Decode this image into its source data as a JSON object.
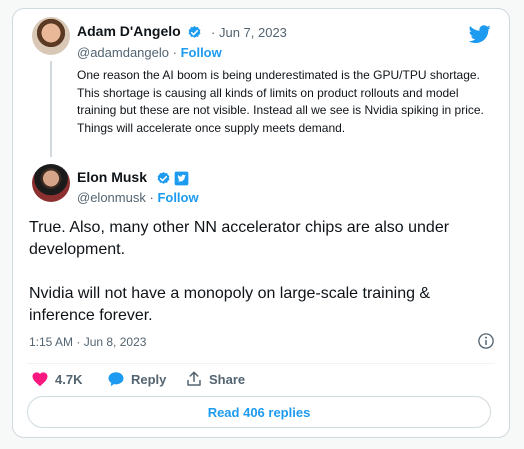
{
  "quoted_tweet": {
    "author_name": "Adam D'Angelo",
    "handle": "@adamdangelo",
    "separator": "·",
    "follow_label": "Follow",
    "date": "Jun 7, 2023",
    "text": "One reason the AI boom is being underestimated is the GPU/TPU shortage. This shortage is causing all kinds of limits on product rollouts and model training but these are not visible. Instead all we see is Nvidia spiking in price. Things will accelerate once supply meets demand."
  },
  "main_tweet": {
    "author_name": "Elon Musk",
    "handle": "@elonmusk",
    "separator": "·",
    "follow_label": "Follow",
    "text": "True. Also, many other NN accelerator chips are also under development.\n\nNvidia will not have a monopoly on large-scale training & inference forever.",
    "timestamp": "1:15 AM · Jun 8, 2023"
  },
  "actions": {
    "like_count": "4.7K",
    "reply_label": "Reply",
    "share_label": "Share"
  },
  "read_replies_label": "Read 406 replies",
  "icons": {
    "logo": "twitter-bird-icon",
    "verified": "verified-badge-icon",
    "affiliate": "twitter-affiliate-badge-icon",
    "info": "info-icon",
    "like": "heart-icon",
    "reply": "speech-bubble-icon",
    "share": "share-arrow-icon"
  },
  "colors": {
    "accent": "#1d9bf0",
    "like": "#f91880",
    "text_primary": "#0f1419",
    "text_secondary": "#536471"
  }
}
